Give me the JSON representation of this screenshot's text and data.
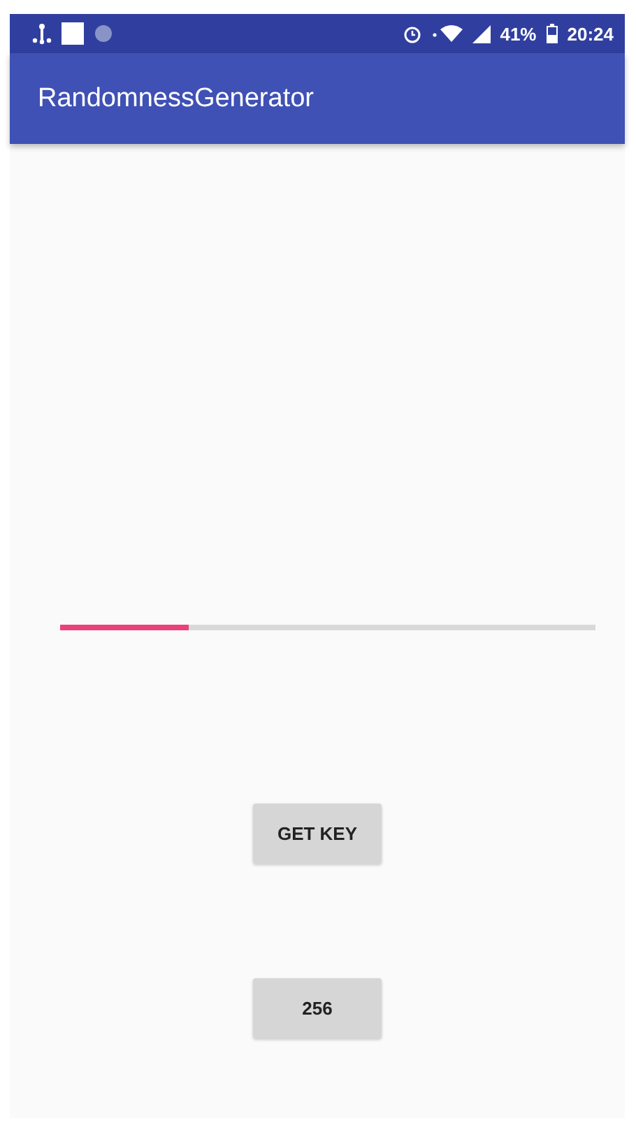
{
  "status_bar": {
    "battery": "41%",
    "time": "20:24"
  },
  "app_bar": {
    "title": "RandomnessGenerator"
  },
  "progress": {
    "level": 0.24
  },
  "buttons": [
    {
      "label": "GET KEY"
    },
    {
      "label": "256"
    }
  ]
}
